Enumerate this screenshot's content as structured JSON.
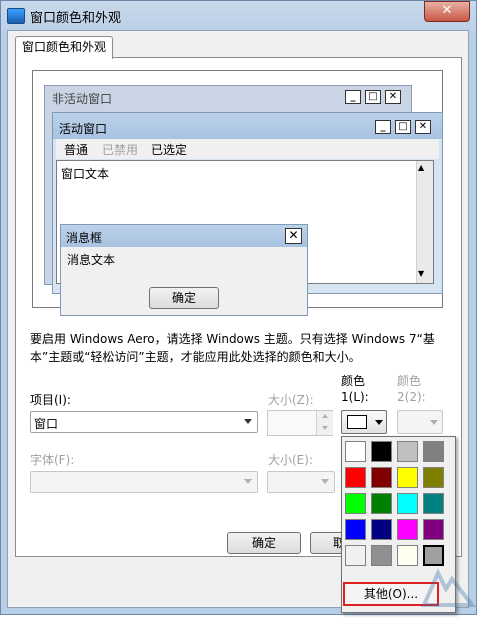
{
  "window": {
    "title": "窗口颜色和外观",
    "close_glyph": "✕"
  },
  "tab": {
    "label": "窗口颜色和外观"
  },
  "preview": {
    "inactive_title": "非活动窗口",
    "active_title": "活动窗口",
    "menu": {
      "normal": "普通",
      "disabled": "已禁用",
      "selected": "已选定"
    },
    "window_text": "窗口文本",
    "msgbox": {
      "title": "消息框",
      "text": "消息文本",
      "ok": "确定"
    },
    "caption_buttons": {
      "min": "_",
      "max": "□",
      "close": "✕"
    }
  },
  "info_text": "要启用 Windows Aero，请选择 Windows 主题。只有选择 Windows 7“基本”主题或“轻松访问”主题，才能应用此处选择的颜色和大小。",
  "form": {
    "item_label": "项目(I):",
    "item_value": "窗口",
    "size_label": "大小(Z):",
    "color1_label_line1": "颜色",
    "color1_label_line2": "1(L):",
    "color2_label_line1": "颜色",
    "color2_label_line2": "2(2):",
    "font_label": "字体(F):",
    "font_size_label": "大小(E):"
  },
  "buttons": {
    "ok": "确定",
    "cancel": "取"
  },
  "palette": {
    "colors": [
      "#ffffff",
      "#000000",
      "#c0c0c0",
      "#808080",
      "#ff0000",
      "#800000",
      "#ffff00",
      "#808000",
      "#00ff00",
      "#008000",
      "#00ffff",
      "#008080",
      "#0000ff",
      "#000080",
      "#ff00ff",
      "#800080",
      "#f0f0f0",
      "#909090",
      "#fffff0",
      "#a0a0a0"
    ],
    "other_label": "其他(O)..."
  }
}
